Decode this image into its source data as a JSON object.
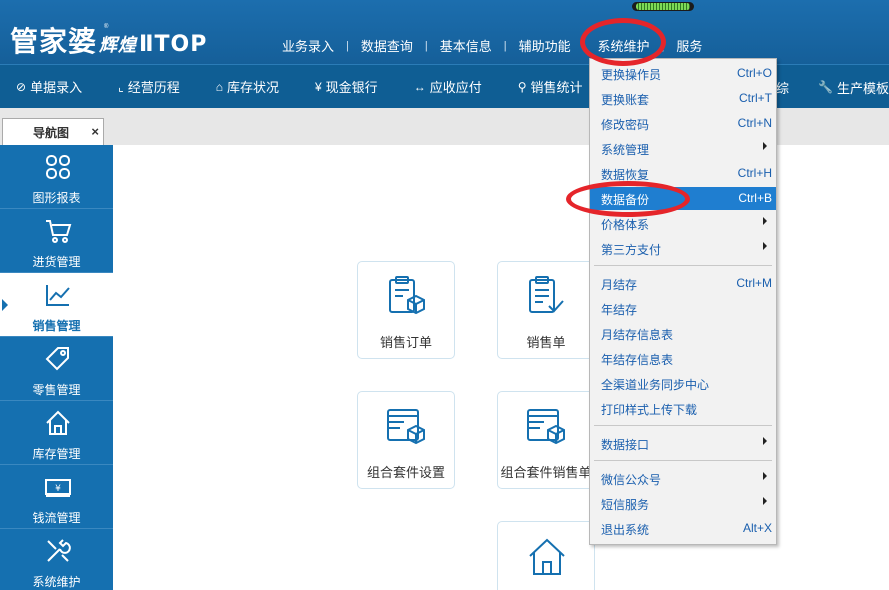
{
  "app": {
    "logo_main": "管家婆",
    "logo_sub": "辉煌",
    "logo_top": "ⅡTOP",
    "logo_mark": "®"
  },
  "top_menu": [
    "业务录入",
    "数据查询",
    "基本信息",
    "辅助功能",
    "系统维护",
    "服务"
  ],
  "toolbar": {
    "items": [
      {
        "icon": "⊘",
        "label": "单据录入"
      },
      {
        "icon": "⌞",
        "label": "经营历程"
      },
      {
        "icon": "⌂",
        "label": "库存状况"
      },
      {
        "icon": "¥",
        "label": "现金银行"
      },
      {
        "icon": "↔",
        "label": "应收应付"
      },
      {
        "icon": "⚲",
        "label": "销售统计"
      }
    ],
    "hidden_fragment": "综",
    "right_item": {
      "icon": "🔧",
      "label": "生产模板"
    }
  },
  "tab": {
    "label": "导航图",
    "close": "×"
  },
  "sidebar": [
    {
      "label": "图形报表",
      "icon": "chart-grid-icon"
    },
    {
      "label": "进货管理",
      "icon": "cart-icon"
    },
    {
      "label": "销售管理",
      "icon": "trend-icon"
    },
    {
      "label": "零售管理",
      "icon": "tag-icon"
    },
    {
      "label": "库存管理",
      "icon": "house-icon"
    },
    {
      "label": "钱流管理",
      "icon": "money-icon"
    },
    {
      "label": "系统维护",
      "icon": "tools-icon"
    }
  ],
  "cards": [
    {
      "label": "销售订单",
      "icon": "order-box-icon"
    },
    {
      "label": "销售单",
      "icon": "checklist-icon"
    },
    {
      "label": "组合套件设置",
      "icon": "bundle-settings-icon"
    },
    {
      "label": "组合套件销售单",
      "icon": "bundle-sales-icon"
    },
    {
      "label": "",
      "icon": "house-icon"
    }
  ],
  "dropdown": {
    "items": [
      {
        "label": "更换操作员",
        "shortcut": "Ctrl+O"
      },
      {
        "label": "更换账套",
        "shortcut": "Ctrl+T"
      },
      {
        "label": "修改密码",
        "shortcut": "Ctrl+N"
      },
      {
        "label": "系统管理",
        "shortcut": "",
        "submenu": true
      },
      {
        "label": "数据恢复",
        "shortcut": "Ctrl+H"
      },
      {
        "label": "数据备份",
        "shortcut": "Ctrl+B"
      },
      {
        "label": "价格体系",
        "shortcut": "",
        "submenu": true
      },
      {
        "label": "第三方支付",
        "shortcut": "",
        "submenu": true
      },
      {
        "label": "月结存",
        "shortcut": "Ctrl+M"
      },
      {
        "label": "年结存",
        "shortcut": ""
      },
      {
        "label": "月结存信息表",
        "shortcut": ""
      },
      {
        "label": "年结存信息表",
        "shortcut": ""
      },
      {
        "label": "全渠道业务同步中心",
        "shortcut": ""
      },
      {
        "label": "打印样式上传下载",
        "shortcut": ""
      },
      {
        "label": "数据接口",
        "shortcut": "",
        "submenu": true
      },
      {
        "label": "微信公众号",
        "shortcut": "",
        "submenu": true
      },
      {
        "label": "短信服务",
        "shortcut": "",
        "submenu": true
      },
      {
        "label": "退出系统",
        "shortcut": "Alt+X"
      }
    ]
  },
  "colors": {
    "header_blue": "#1c6eae",
    "toolbar_blue": "#0f5e94",
    "sidebar_blue": "#1570b0",
    "menu_highlight": "#1f7ed0",
    "annotation_red": "#e5252a"
  }
}
